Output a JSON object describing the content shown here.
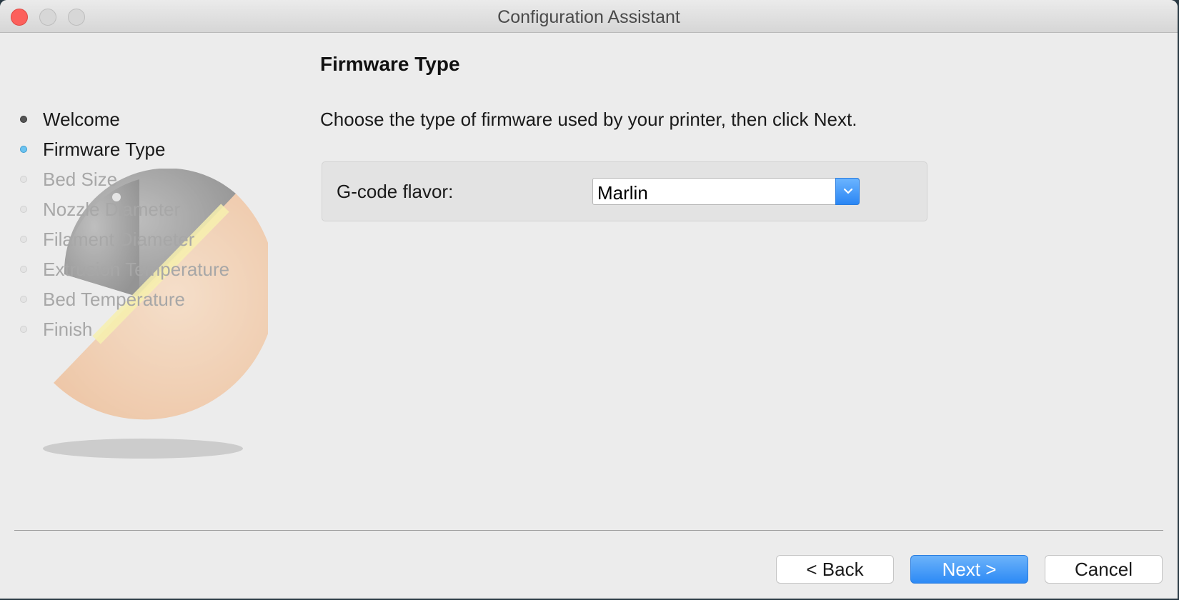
{
  "window": {
    "title": "Configuration Assistant"
  },
  "sidebar": {
    "steps": [
      {
        "label": "Welcome",
        "state": "done"
      },
      {
        "label": "Firmware Type",
        "state": "current"
      },
      {
        "label": "Bed Size",
        "state": "todo"
      },
      {
        "label": "Nozzle Diameter",
        "state": "todo"
      },
      {
        "label": "Filament Diameter",
        "state": "todo"
      },
      {
        "label": "Extrusion Temperature",
        "state": "todo"
      },
      {
        "label": "Bed Temperature",
        "state": "todo"
      },
      {
        "label": "Finish",
        "state": "todo"
      }
    ]
  },
  "page": {
    "title": "Firmware Type",
    "instructions": "Choose the type of firmware used by your printer, then click Next.",
    "field_label": "G-code flavor:",
    "field_value": "Marlin"
  },
  "footer": {
    "back_label": "< Back",
    "next_label": "Next >",
    "cancel_label": "Cancel"
  },
  "colors": {
    "accent": "#2d8af5",
    "current_step": "#6cc3f0",
    "close_button": "#fc605c"
  }
}
